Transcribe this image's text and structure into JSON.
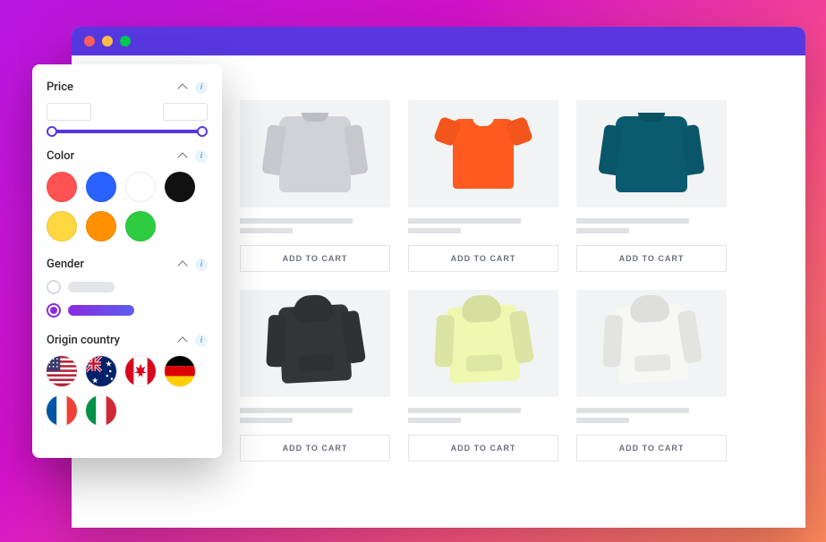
{
  "filters": {
    "price": {
      "label": "Price",
      "min": "",
      "max": ""
    },
    "color": {
      "label": "Color",
      "options": [
        {
          "name": "red",
          "hex": "#ff5252"
        },
        {
          "name": "blue",
          "hex": "#2962ff"
        },
        {
          "name": "white",
          "hex": "#ffffff"
        },
        {
          "name": "black",
          "hex": "#111111"
        },
        {
          "name": "yellow",
          "hex": "#ffd740"
        },
        {
          "name": "orange",
          "hex": "#ff9100"
        },
        {
          "name": "green",
          "hex": "#2ecc40"
        }
      ]
    },
    "gender": {
      "label": "Gender",
      "options": [
        {
          "selected": false
        },
        {
          "selected": true
        }
      ]
    },
    "origin": {
      "label": "Origin country",
      "countries": [
        "us",
        "au",
        "ca",
        "de",
        "fr",
        "it"
      ]
    }
  },
  "products": [
    {
      "id": "p1",
      "name": "grey-sweatshirt",
      "shape": "sweatshirt",
      "color": "#cfd3d8",
      "cart_label": "ADD TO CART"
    },
    {
      "id": "p2",
      "name": "orange-tshirt",
      "shape": "tshirt",
      "color": "#ff5a1f",
      "cart_label": "ADD TO CART"
    },
    {
      "id": "p3",
      "name": "teal-sweatshirt",
      "shape": "sweatshirt",
      "color": "#0a5b6e",
      "cart_label": "ADD TO CART"
    },
    {
      "id": "p4",
      "name": "black-hoodie",
      "shape": "hoodie",
      "color": "#333537",
      "cart_label": "ADD TO CART"
    },
    {
      "id": "p5",
      "name": "lime-hoodie",
      "shape": "hoodie",
      "color": "#eef8b0",
      "cart_label": "ADD TO CART"
    },
    {
      "id": "p6",
      "name": "white-hoodie",
      "shape": "hoodie",
      "color": "#f7f7f4",
      "cart_label": "ADD TO CART"
    }
  ]
}
